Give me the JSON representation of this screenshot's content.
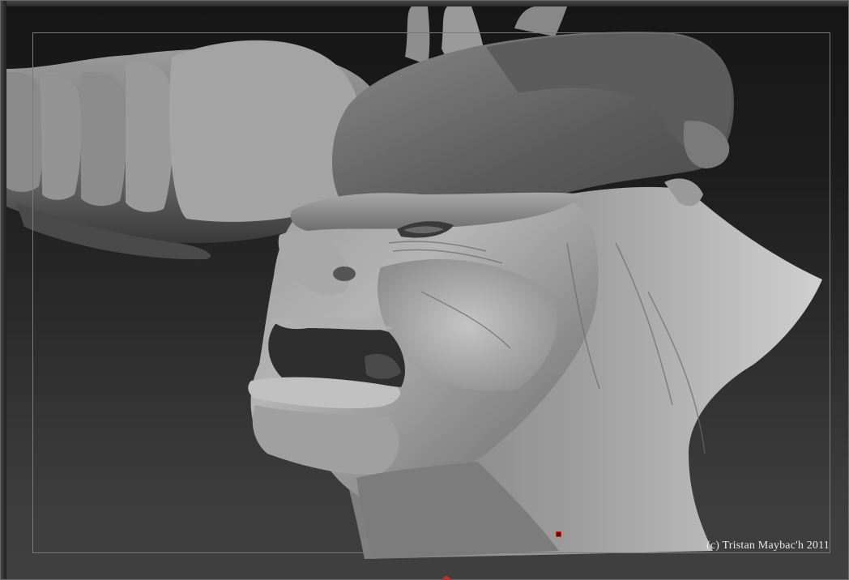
{
  "viewport": {
    "title": "",
    "content": "sculpt-render-demon-head"
  },
  "watermark": {
    "text": "(c) Tristan Maybac'h 2011"
  },
  "colors": {
    "background_top": "#161616",
    "background_bottom": "#404040",
    "sculpt_light": "#c8c8c8",
    "sculpt_mid": "#8c8c8c",
    "sculpt_dark": "#3e3e3e",
    "guide_frame": "#7a7a7a",
    "marker": "#c0302a"
  }
}
